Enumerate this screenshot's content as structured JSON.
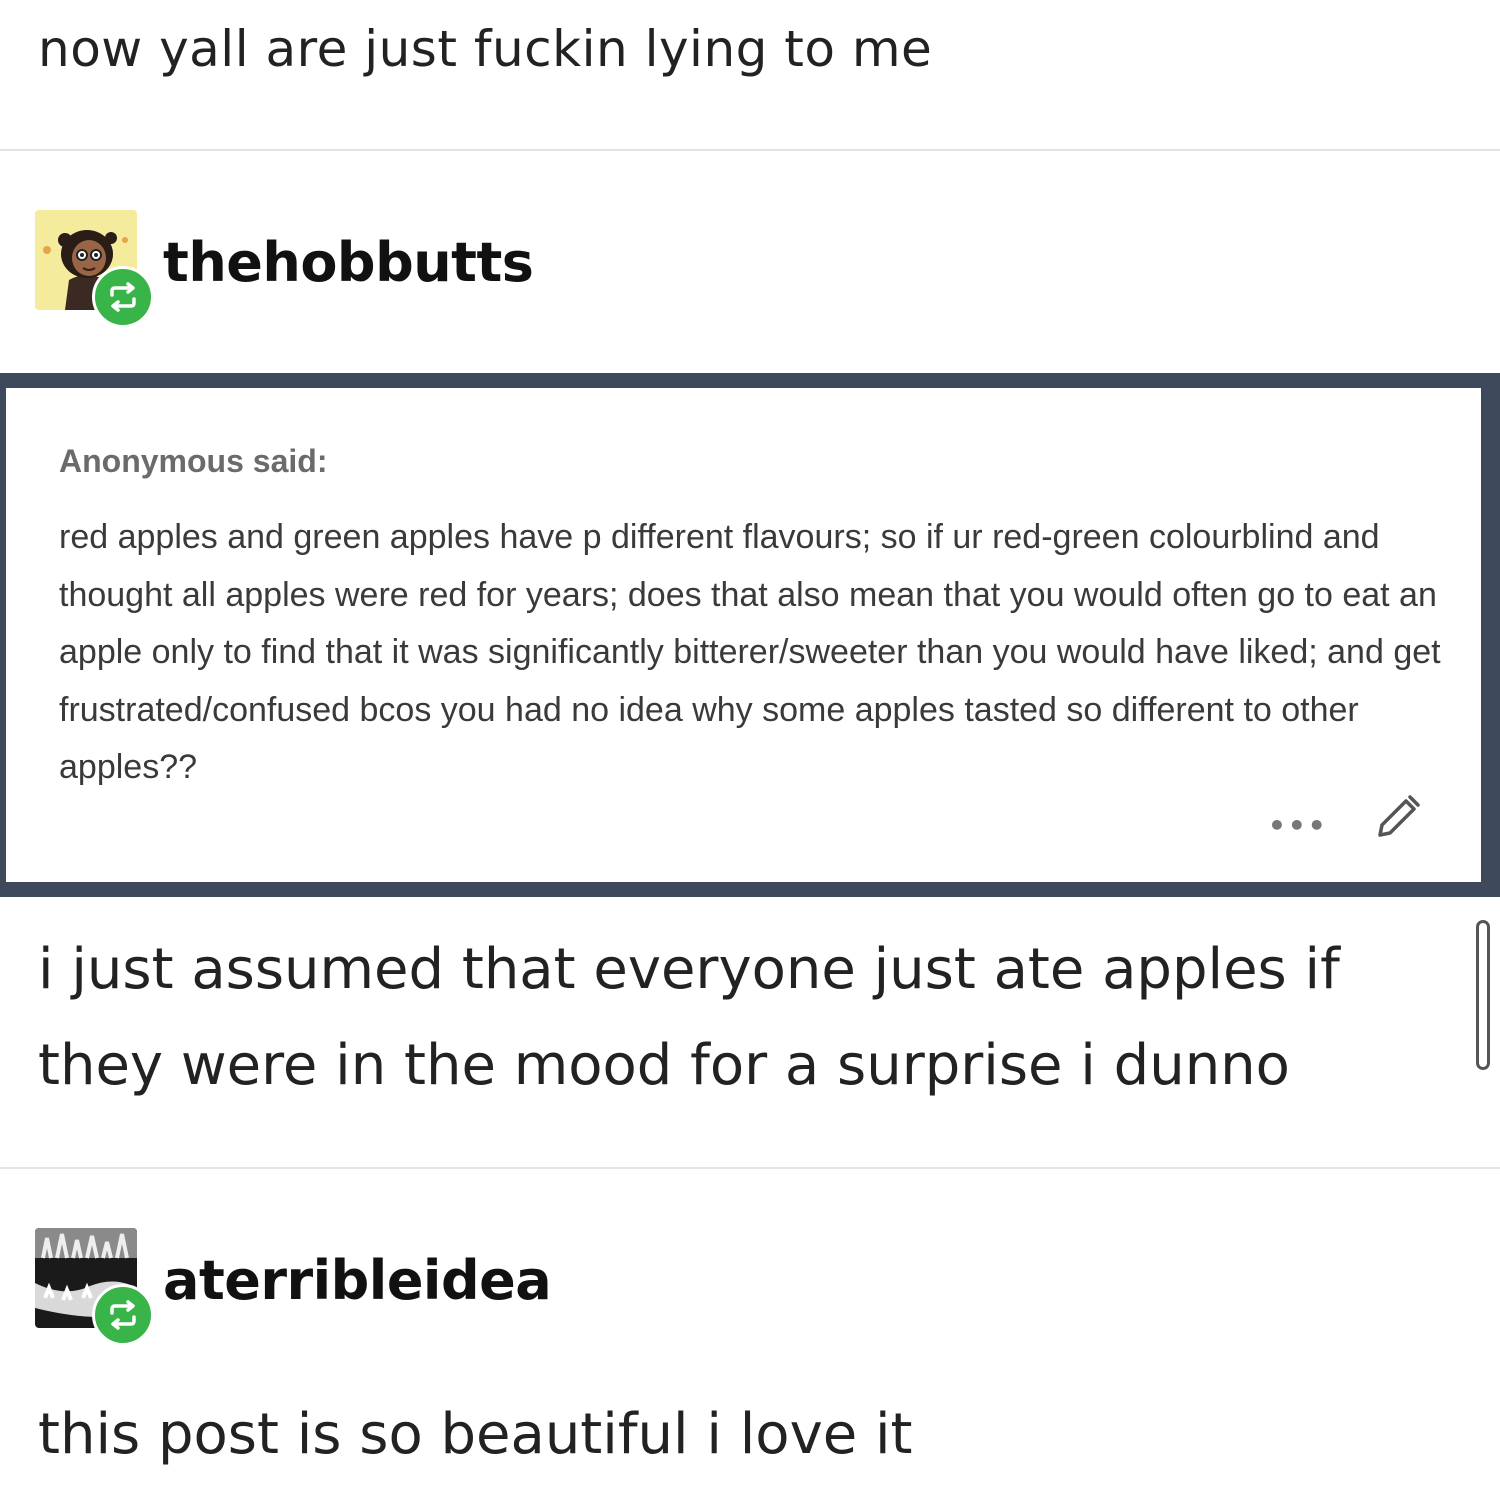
{
  "top_post": {
    "text": "now yall are just fuckin lying to me"
  },
  "reblog_1": {
    "username": "thehobbutts",
    "avatar_icon": "illustrated-avatar-icon",
    "badge_icon": "reblog-icon",
    "badge_color": "#38b449"
  },
  "ask": {
    "asker_label": "Anonymous said:",
    "question": "red apples and green apples have p different flavours; so if ur red-green colourblind and thought all apples were red for years; does that also mean that you would often go to eat an apple only to find that it was significantly bitterer/sweeter than you would have liked; and get frustrated/confused bcos you had no idea why some apples tasted so different to other apples??",
    "more_icon": "more-options-icon",
    "edit_icon": "pencil-icon",
    "frame_color": "#3e4a5c"
  },
  "answer": {
    "text": "i just assumed that everyone just ate apples if they were in the mood for a surprise i dunno"
  },
  "reblog_2": {
    "username": "aterribleidea",
    "avatar_icon": "photo-avatar-icon",
    "badge_icon": "reblog-icon",
    "badge_color": "#38b449"
  },
  "reply": {
    "text": "this post is so beautiful i love it"
  }
}
